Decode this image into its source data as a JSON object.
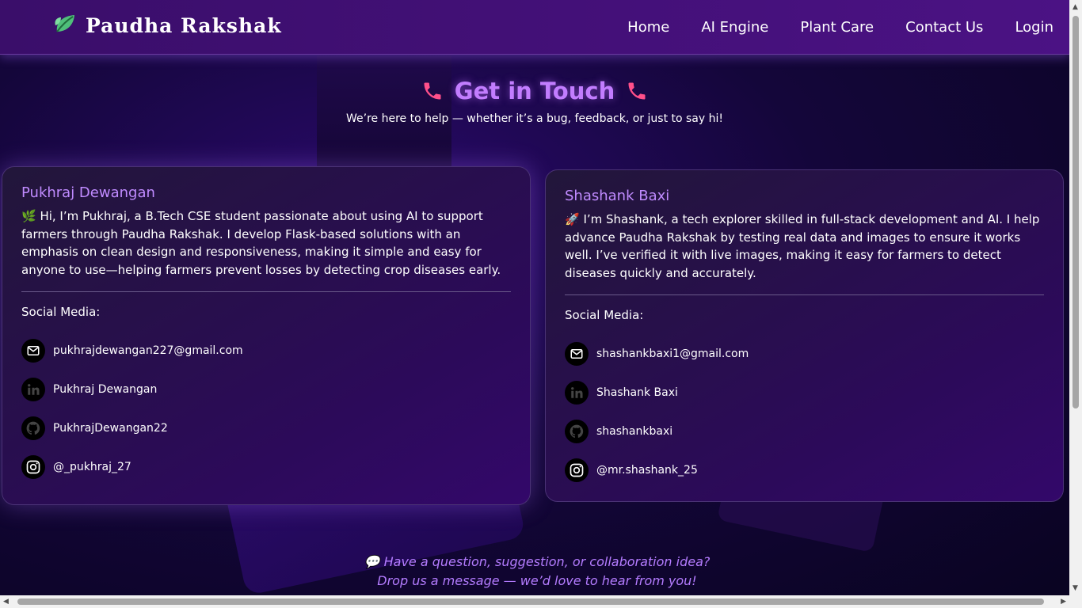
{
  "nav": {
    "brand": "Paudha Rakshak",
    "links": [
      "Home",
      "AI Engine",
      "Plant Care",
      "Contact Us",
      "Login"
    ]
  },
  "header": {
    "title": "Get in Touch",
    "subtitle": "We’re here to help — whether it’s a bug, feedback, or just to say hi!"
  },
  "cards": [
    {
      "name": "Pukhraj Dewangan",
      "bio": "🌿 Hi, I’m Pukhraj, a B.Tech CSE student passionate about using AI to support farmers through Paudha Rakshak. I develop Flask-based solutions with an emphasis on clean design and responsiveness, making it simple and easy for anyone to use—helping farmers prevent losses by detecting crop diseases early.",
      "social_title": "Social Media:",
      "email": "pukhrajdewangan227@gmail.com",
      "linkedin": "Pukhraj Dewangan",
      "github": "PukhrajDewangan22",
      "instagram": "@_pukhraj_27"
    },
    {
      "name": "Shashank Baxi",
      "bio": "🚀 I’m Shashank, a tech explorer skilled in full-stack development and AI. I help advance Paudha Rakshak by testing real data and images to ensure it works well. I’ve verified it with live images, making it easy for farmers to detect diseases quickly and accurately.",
      "social_title": "Social Media:",
      "email": "shashankbaxi1@gmail.com",
      "linkedin": "Shashank Baxi",
      "github": "shashankbaxi",
      "instagram": "@mr.shashank_25"
    }
  ],
  "footer": {
    "line1": "💬 Have a question, suggestion, or collaboration idea?",
    "line2": "Drop us a message — we’d love to hear from you!"
  },
  "colors": {
    "accent": "#c27dff",
    "nav_bg": "#3a0e6a"
  }
}
